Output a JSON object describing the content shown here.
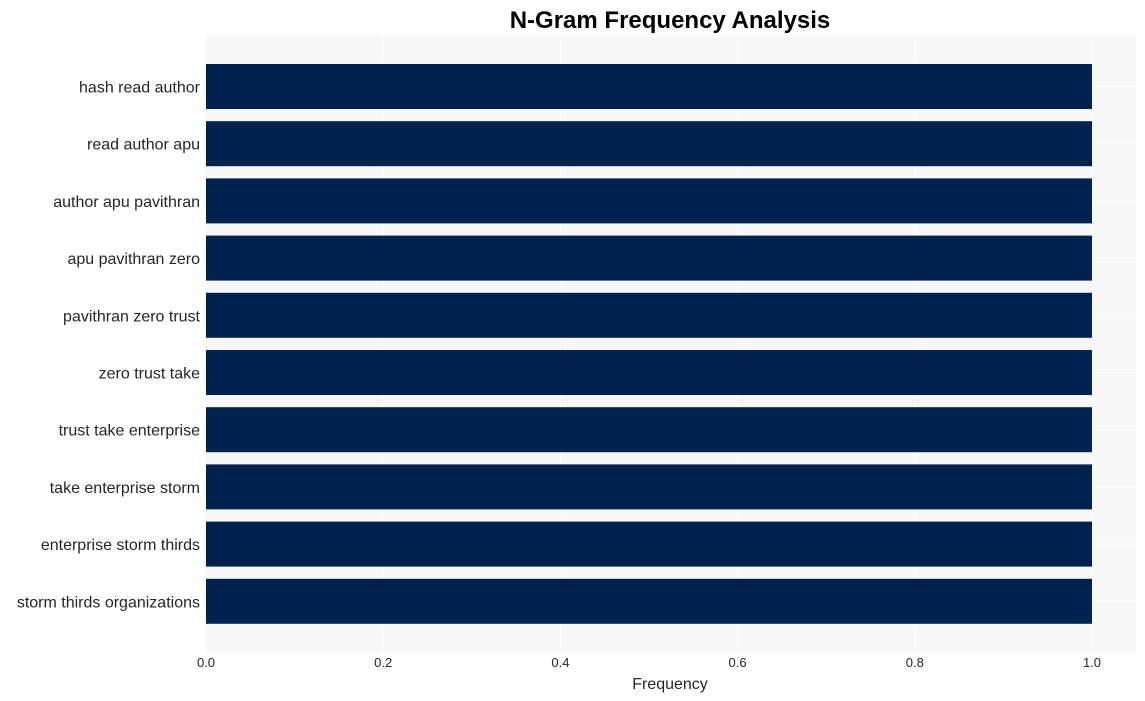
{
  "chart_data": {
    "type": "bar",
    "orientation": "horizontal",
    "title": "N-Gram Frequency Analysis",
    "xlabel": "Frequency",
    "ylabel": "",
    "xlim": [
      0,
      1.0
    ],
    "xticks": [
      "0.0",
      "0.2",
      "0.4",
      "0.6",
      "0.8",
      "1.0"
    ],
    "xtick_values": [
      0,
      0.2,
      0.4,
      0.6,
      0.8,
      1.0
    ],
    "grid": true,
    "bar_color": "#00224e",
    "background_color": "#f7f7f7",
    "categories": [
      "hash read author",
      "read author apu",
      "author apu pavithran",
      "apu pavithran zero",
      "pavithran zero trust",
      "zero trust take",
      "trust take enterprise",
      "take enterprise storm",
      "enterprise storm thirds",
      "storm thirds organizations"
    ],
    "values": [
      1,
      1,
      1,
      1,
      1,
      1,
      1,
      1,
      1,
      1
    ]
  }
}
